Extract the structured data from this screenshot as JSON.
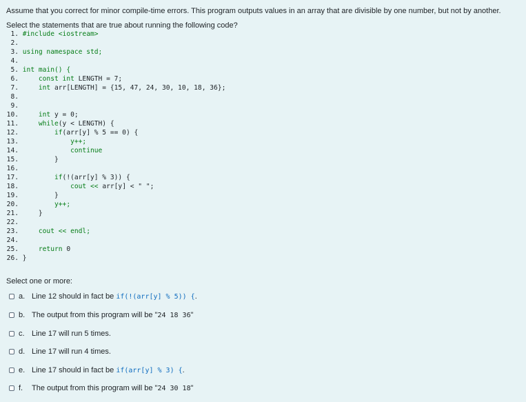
{
  "question": {
    "text": "Assume that you correct for minor compile-time errors. This program outputs values in an array that are divisible by one number, but not by another. Select the statements that are true about running the following code?"
  },
  "code": [
    {
      "n": "1.",
      "parts": [
        [
          "#include <iostream>",
          "green"
        ]
      ]
    },
    {
      "n": "2.",
      "parts": []
    },
    {
      "n": "3.",
      "parts": [
        [
          "using namespace std;",
          "green"
        ]
      ]
    },
    {
      "n": "4.",
      "parts": []
    },
    {
      "n": "5.",
      "parts": [
        [
          "int main() {",
          "green"
        ]
      ]
    },
    {
      "n": "6.",
      "parts": [
        [
          "    const int ",
          "green"
        ],
        [
          "LENGTH = 7;",
          "plain"
        ]
      ]
    },
    {
      "n": "7.",
      "parts": [
        [
          "    int ",
          "green"
        ],
        [
          "arr[LENGTH] = {15, 47, 24, 30, 10, 18, 36};",
          "plain"
        ]
      ]
    },
    {
      "n": "8.",
      "parts": []
    },
    {
      "n": "9.",
      "parts": []
    },
    {
      "n": "10.",
      "parts": [
        [
          "    int ",
          "green"
        ],
        [
          "y = 0;",
          "plain"
        ]
      ]
    },
    {
      "n": "11.",
      "parts": [
        [
          "    while",
          "green"
        ],
        [
          "(y < LENGTH) {",
          "plain"
        ]
      ]
    },
    {
      "n": "12.",
      "parts": [
        [
          "        if",
          "green"
        ],
        [
          "(arr[y] % 5 == 0) {",
          "plain"
        ]
      ]
    },
    {
      "n": "13.",
      "parts": [
        [
          "            y++;",
          "green"
        ]
      ]
    },
    {
      "n": "14.",
      "parts": [
        [
          "            continue",
          "green"
        ]
      ]
    },
    {
      "n": "15.",
      "parts": [
        [
          "        }",
          "plain"
        ]
      ]
    },
    {
      "n": "16.",
      "parts": []
    },
    {
      "n": "17.",
      "parts": [
        [
          "        if",
          "green"
        ],
        [
          "(!(arr[y] % 3)) {",
          "plain"
        ]
      ]
    },
    {
      "n": "18.",
      "parts": [
        [
          "            cout << ",
          "green"
        ],
        [
          "arr[y] < \" \";",
          "plain"
        ]
      ]
    },
    {
      "n": "19.",
      "parts": [
        [
          "        }",
          "plain"
        ]
      ]
    },
    {
      "n": "20.",
      "parts": [
        [
          "        y++;",
          "green"
        ]
      ]
    },
    {
      "n": "21.",
      "parts": [
        [
          "    }",
          "plain"
        ]
      ]
    },
    {
      "n": "22.",
      "parts": []
    },
    {
      "n": "23.",
      "parts": [
        [
          "    cout << endl;",
          "green"
        ]
      ]
    },
    {
      "n": "24.",
      "parts": []
    },
    {
      "n": "25.",
      "parts": [
        [
          "    return ",
          "green"
        ],
        [
          "0",
          "plain"
        ]
      ]
    },
    {
      "n": "26.",
      "parts": [
        [
          "}",
          "plain"
        ]
      ]
    }
  ],
  "prompt": "Select one or more:",
  "answers": [
    {
      "letter": "a.",
      "pre": "Line 12 should in fact be ",
      "code": "if(!(arr[y] % 5)) {",
      "post": ".",
      "code_style": "link"
    },
    {
      "letter": "b.",
      "pre": "The output from this program will be \"",
      "code": "24 18 36",
      "post": "\"",
      "code_style": "mono"
    },
    {
      "letter": "c.",
      "pre": "Line 17 will run 5 times.",
      "code": "",
      "post": "",
      "code_style": "none"
    },
    {
      "letter": "d.",
      "pre": "Line 17 will run 4 times.",
      "code": "",
      "post": "",
      "code_style": "none"
    },
    {
      "letter": "e.",
      "pre": "Line 17 should in fact be ",
      "code": "if(arr[y] % 3) {",
      "post": ".",
      "code_style": "link"
    },
    {
      "letter": "f.",
      "pre": "The output from this program will be \"",
      "code": "24 30 18",
      "post": "\"",
      "code_style": "mono"
    }
  ]
}
